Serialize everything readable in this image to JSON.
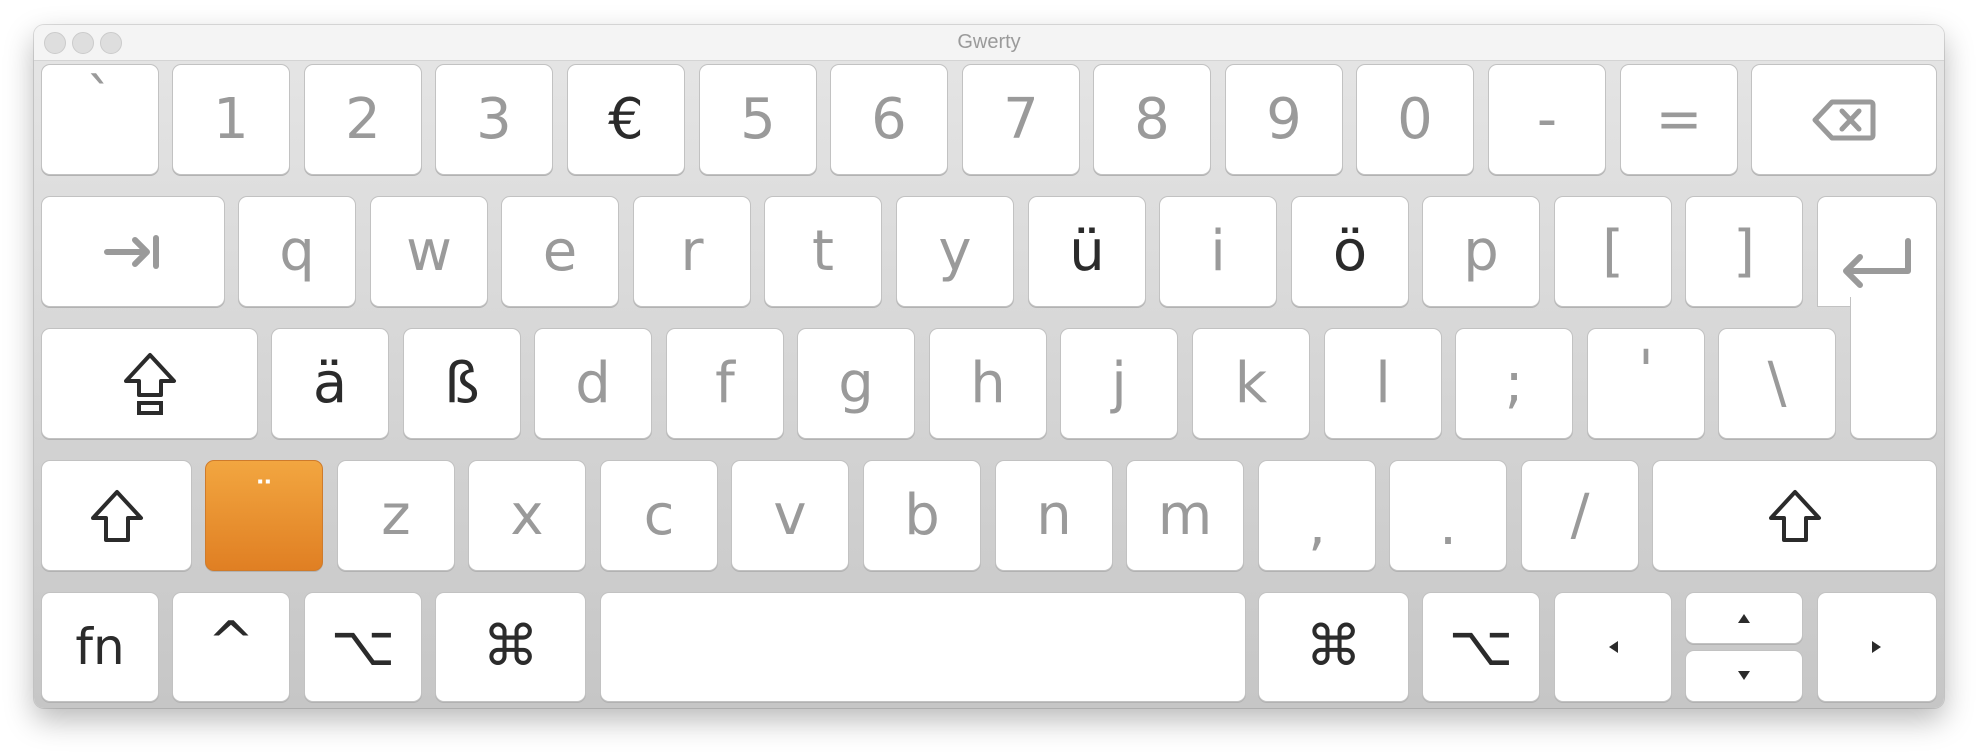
{
  "window": {
    "title": "Gwerty"
  },
  "rows": {
    "row1": [
      "`",
      "1",
      "2",
      "3",
      "€",
      "5",
      "6",
      "7",
      "8",
      "9",
      "0",
      "-",
      "="
    ],
    "row2": [
      "q",
      "w",
      "e",
      "r",
      "t",
      "y",
      "ü",
      "i",
      "ö",
      "p",
      "[",
      "]"
    ],
    "row3": [
      "ä",
      "ß",
      "d",
      "f",
      "g",
      "h",
      "j",
      "k",
      "l",
      ";",
      "'",
      "\\"
    ],
    "row4": [
      "z",
      "x",
      "c",
      "v",
      "b",
      "n",
      "m",
      ",",
      ".",
      "/"
    ]
  },
  "modifiers": {
    "fn": "fn",
    "control": "^",
    "option": "⌥",
    "command": "⌘",
    "dead_key": "¨"
  },
  "icons": {
    "delete": "delete-icon",
    "tab": "tab-icon",
    "return": "return-icon",
    "caps_lock": "caps-lock-icon",
    "shift": "shift-icon",
    "arrows": [
      "arrow-left-icon",
      "arrow-up-icon",
      "arrow-down-icon",
      "arrow-right-icon"
    ]
  },
  "colors": {
    "accent": "#e8902f",
    "dark_label": "#2b2b2b",
    "light_label": "#9a9a9a"
  }
}
